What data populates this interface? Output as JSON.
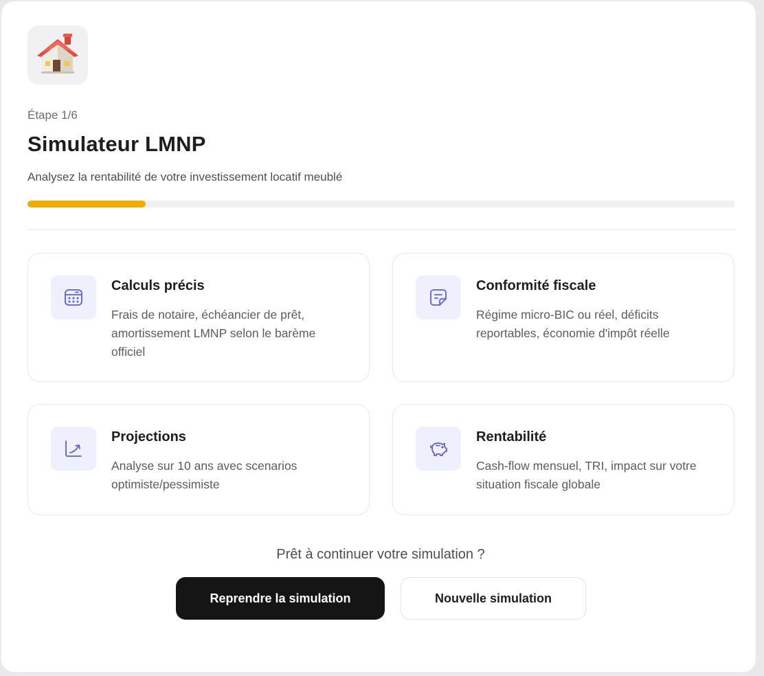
{
  "header": {
    "logo_icon": "house-icon",
    "step_label": "Étape 1/6",
    "title": "Simulateur LMNP",
    "subtitle": "Analysez la rentabilité de votre investissement locatif meublé"
  },
  "progress": {
    "current_step": 1,
    "total_steps": 6,
    "fraction": 0.1667,
    "fill_color": "#f0ab00",
    "track_color": "#f0f0f2"
  },
  "features": [
    {
      "icon": "calculator-icon",
      "title": "Calculs précis",
      "description": "Frais de notaire, échéancier de prêt, amortissement LMNP selon le barème officiel"
    },
    {
      "icon": "document-icon",
      "title": "Conformité fiscale",
      "description": "Régime micro-BIC ou réel, déficits reportables, économie d'impôt réelle"
    },
    {
      "icon": "trend-chart-icon",
      "title": "Projections",
      "description": "Analyse sur 10 ans avec scenarios optimiste/pessimiste"
    },
    {
      "icon": "piggy-bank-icon",
      "title": "Rentabilité",
      "description": "Cash-flow mensuel, TRI, impact sur votre situation fiscale globale"
    }
  ],
  "cta": {
    "prompt": "Prêt à continuer votre simulation ?",
    "resume_label": "Reprendre la simulation",
    "new_label": "Nouvelle simulation"
  },
  "colors": {
    "accent": "#f0ab00",
    "icon_tint": "#5b5fd6",
    "icon_bg": "#eef0fd",
    "primary_button": "#151515"
  }
}
